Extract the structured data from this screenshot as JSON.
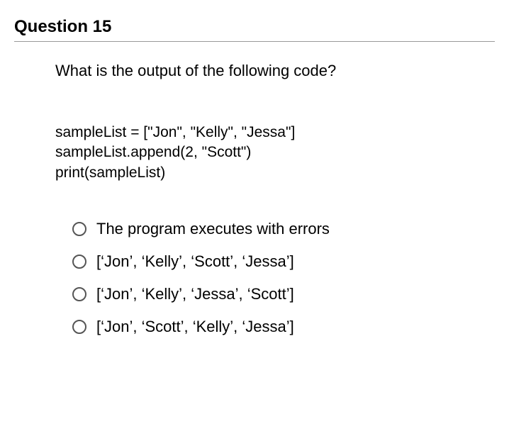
{
  "header": "Question 15",
  "question": "What is the output of the following code?",
  "code": "sampleList = [\"Jon\", \"Kelly\", \"Jessa\"]\nsampleList.append(2, \"Scott\")\nprint(sampleList)",
  "options": [
    "The program executes with errors",
    "[‘Jon’, ‘Kelly’, ‘Scott’, ‘Jessa’]",
    "[‘Jon’, ‘Kelly’, ‘Jessa’, ‘Scott’]",
    "[‘Jon’, ‘Scott’, ‘Kelly’, ‘Jessa’]"
  ]
}
